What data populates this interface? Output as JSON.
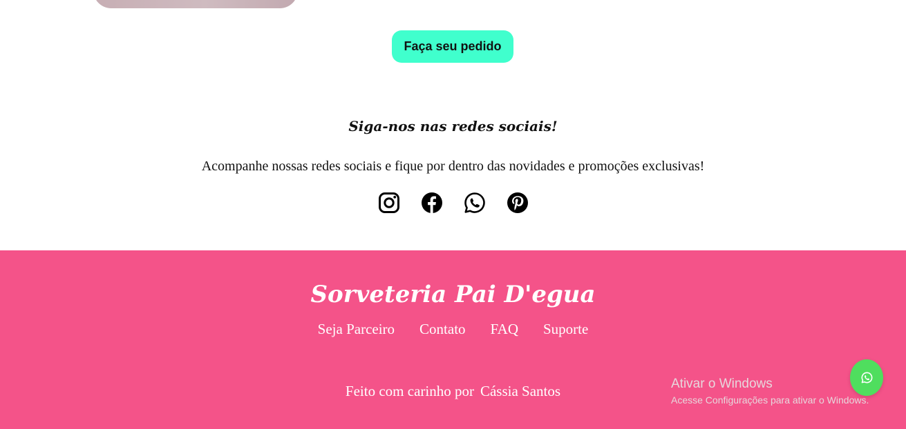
{
  "order_button": {
    "label": "Faça seu pedido"
  },
  "social": {
    "title": "Siga-nos nas redes sociais!",
    "description": "Acompanhe nossas redes sociais e fique por dentro das novidades e promoções exclusivas!",
    "icons": [
      "instagram-icon",
      "facebook-icon",
      "whatsapp-icon",
      "pinterest-icon"
    ]
  },
  "footer": {
    "brand": "Sorveteria Pai D'egua",
    "links": [
      "Seja Parceiro",
      "Contato",
      "FAQ",
      "Suporte"
    ],
    "credit_prefix": "Feito com carinho por",
    "credit_author": "Cássia Santos"
  },
  "watermark": {
    "title": "Ativar o Windows",
    "subtitle": "Acesse Configurações para ativar o Windows."
  },
  "floating_button": {
    "icon": "whatsapp-icon"
  },
  "colors": {
    "accent_button": "#40ffcd",
    "footer_bg": "#f45389",
    "whatsapp_green": "#4fde5e"
  }
}
